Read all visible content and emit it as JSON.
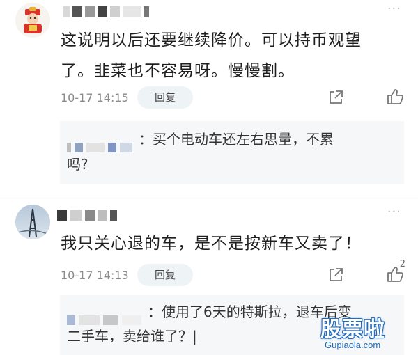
{
  "comments": [
    {
      "text_line1": "这说明以后还要继续降价。可以持币观望",
      "text_line2": "了。韭菜也不容易呀。慢慢割。",
      "time": "10-17 14:15",
      "reply_label": "回复",
      "more_label": "···",
      "reply": {
        "text_line1": "：买个电动车还左右思量，不累",
        "text_line2": "吗?"
      }
    },
    {
      "text": "我只关心退的车，是不是按新车又卖了！",
      "time": "10-17 14:13",
      "reply_label": "回复",
      "more_label": "···",
      "like_count": "2",
      "reply": {
        "text_line1": "：使用了6天的特斯拉，退车后变",
        "text_line2": "二手车，卖给谁了？|"
      }
    }
  ],
  "watermark": {
    "main": "股票啦",
    "sub": "Gupiaola.com"
  },
  "icons": {
    "share": "share-icon",
    "like": "thumbs-up-icon",
    "more": "more-dots-icon"
  },
  "colors": {
    "reply_box_bg": "#f5f7f9",
    "reply_button_bg": "#eef3f6",
    "time_text": "#8a8a8a",
    "watermark_blue": "#1f6bbf"
  }
}
